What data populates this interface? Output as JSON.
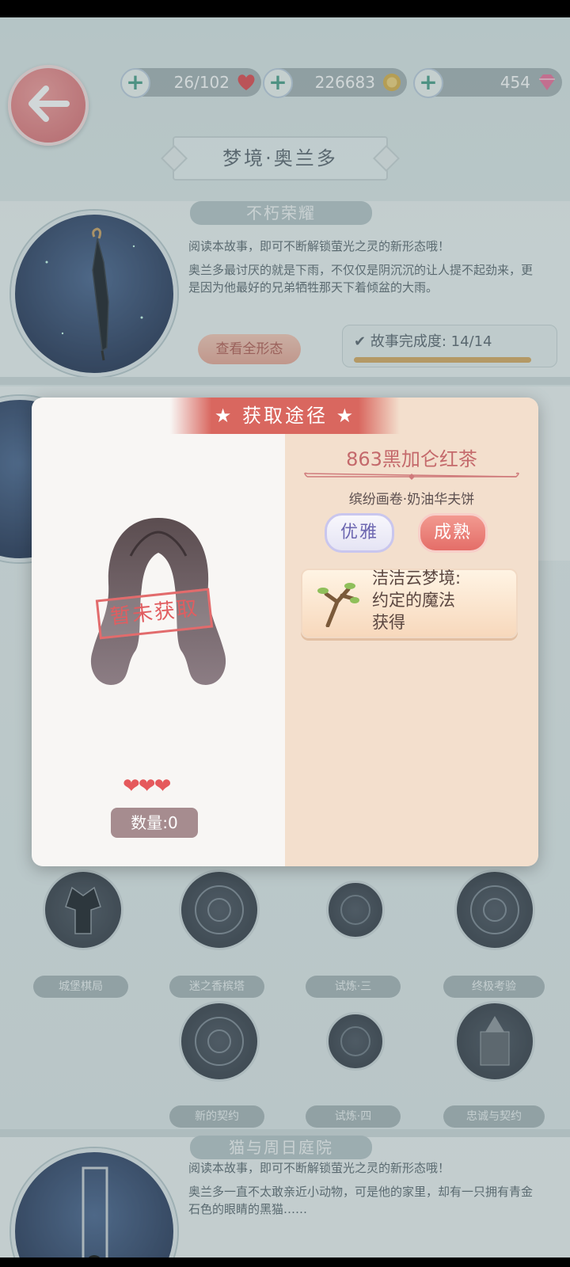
{
  "resources": {
    "hearts": "26/102",
    "coins": "226683",
    "diamonds": "454"
  },
  "page_title": "梦境·奥兰多",
  "story1": {
    "ribbon": "不朽荣耀",
    "desc1": "阅读本故事，即可不断解锁萤光之灵的新形态哦！",
    "desc2": "奥兰多最讨厌的就是下雨，不仅仅是阴沉沉的让人提不起劲来，更是因为他最好的兄弟牺牲那天下着倾盆的大雨。",
    "view_all_button": "查看全形态",
    "progress_label": "故事完成度:",
    "progress_value": "14/14",
    "progress_fraction": 1.0
  },
  "nodes": {
    "row1": [
      "城堡棋局",
      "迷之香槟塔",
      "试炼·三",
      "终极考验"
    ],
    "row2": [
      "新的契约",
      "试炼·四",
      "忠诚与契约"
    ]
  },
  "story2": {
    "ribbon": "猫与周日庭院",
    "desc1": "阅读本故事，即可不断解锁萤光之灵的新形态哦！",
    "desc2": "奥兰多一直不太敢亲近小动物，可是他的家里，却有一只拥有青金石色的眼睛的黑猫……"
  },
  "modal": {
    "title": "获取途径",
    "item_name": "863黑加仑红茶",
    "series": "缤纷画卷·奶油华夫饼",
    "tags": [
      "优雅",
      "成熟"
    ],
    "source_line1": "洁洁云梦境:",
    "source_line2": "约定的魔法",
    "source_line3": "获得",
    "stamp": "暂未获取",
    "hearts": "❤❤❤",
    "quantity": "数量:0"
  },
  "colors": {
    "accent_red": "#d9675f",
    "coin_gold": "#d9b04a",
    "progress_gold": "#d7aa60"
  }
}
